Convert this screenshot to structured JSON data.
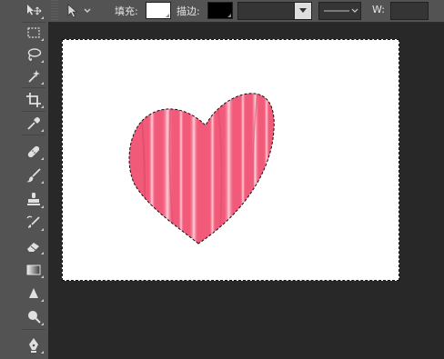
{
  "options_bar": {
    "fill_label": "填充:",
    "stroke_label": "描边:",
    "w_label": "W:",
    "fill_color": "#ffffff",
    "stroke_color": "#000000"
  },
  "toolbar": {
    "tools": [
      {
        "name": "move-tool",
        "icon": "move-icon"
      },
      {
        "name": "marquee-tool",
        "icon": "rect-marquee-icon"
      },
      {
        "name": "lasso-tool",
        "icon": "lasso-icon"
      },
      {
        "name": "magic-wand-tool",
        "icon": "magic-wand-icon"
      },
      {
        "name": "crop-tool",
        "icon": "crop-icon"
      },
      {
        "name": "eyedropper-tool",
        "icon": "eyedropper-icon"
      },
      {
        "name": "healing-brush-tool",
        "icon": "bandage-icon"
      },
      {
        "name": "brush-tool",
        "icon": "brush-icon"
      },
      {
        "name": "clone-stamp-tool",
        "icon": "stamp-icon"
      },
      {
        "name": "history-brush-tool",
        "icon": "history-brush-icon"
      },
      {
        "name": "eraser-tool",
        "icon": "eraser-icon"
      },
      {
        "name": "gradient-tool",
        "icon": "gradient-icon"
      },
      {
        "name": "blur-tool",
        "icon": "blur-icon"
      },
      {
        "name": "dodge-tool",
        "icon": "dodge-icon"
      },
      {
        "name": "pen-tool",
        "icon": "pen-icon"
      }
    ]
  },
  "canvas": {
    "background": "#ffffff",
    "heart_color": "#f25a7a",
    "heart_highlight": "#ffd1dc"
  }
}
